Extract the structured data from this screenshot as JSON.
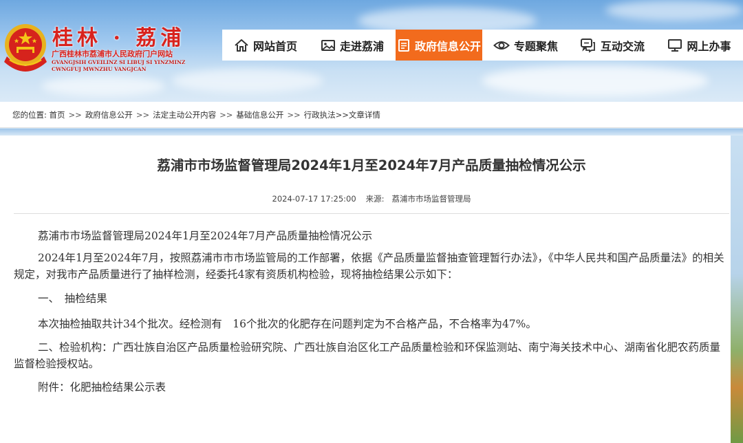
{
  "header": {
    "site_name": "桂林 · 荔浦",
    "site_subtitle": "广西桂林市荔浦市人民政府门户网站",
    "site_zhuang": "GVANGJSIH GVEILINZ SI LIBUJ SI YINZMINZ CWNGFUJ MWNZHU VANGJCAN"
  },
  "nav": [
    {
      "label": "网站首页",
      "icon": "home-icon",
      "active": false
    },
    {
      "label": "走进荔浦",
      "icon": "picture-icon",
      "active": false
    },
    {
      "label": "政府信息公开",
      "icon": "document-icon",
      "active": true
    },
    {
      "label": "专题聚焦",
      "icon": "eye-icon",
      "active": false
    },
    {
      "label": "互动交流",
      "icon": "chat-icon",
      "active": false
    },
    {
      "label": "网上办事",
      "icon": "monitor-icon",
      "active": false
    }
  ],
  "breadcrumb": {
    "prefix": "您的位置:",
    "items": [
      "首页",
      "政府信息公开",
      "法定主动公开内容",
      "基础信息公开",
      "行政执法>>文章详情"
    ],
    "separator": ">>"
  },
  "article": {
    "title": "荔浦市市场监督管理局2024年1月至2024年7月产品质量抽检情况公示",
    "date": "2024-07-17 17:25:00",
    "source_label": "来源:",
    "source": "荔浦市市场监督管理局",
    "paragraphs": [
      "荔浦市市场监督管理局2024年1月至2024年7月产品质量抽检情况公示",
      "2024年1月至2024年7月，按照荔浦市市市场监管局的工作部署，依据《产品质量监督抽查管理暂行办法》，《中华人民共和国产品质量法》的相关规定，对我市产品质量进行了抽样检测，经委托4家有资质机构检验，现将抽检结果公示如下：",
      "一、　抽检结果",
      "本次抽检抽取共计34个批次。经检测有　16个批次的化肥存在问题判定为不合格产品，不合格率为47%。",
      "二、检验机构：广西壮族自治区产品质量检验研究院、广西壮族自治区化工产品质量检验和环保监测站、南宁海关技术中心、湖南省化肥农药质量监督检验授权站。",
      "附件：化肥抽检结果公示表"
    ]
  },
  "colors": {
    "brand_red": "#d8231e",
    "nav_active": "#f26b1d"
  }
}
